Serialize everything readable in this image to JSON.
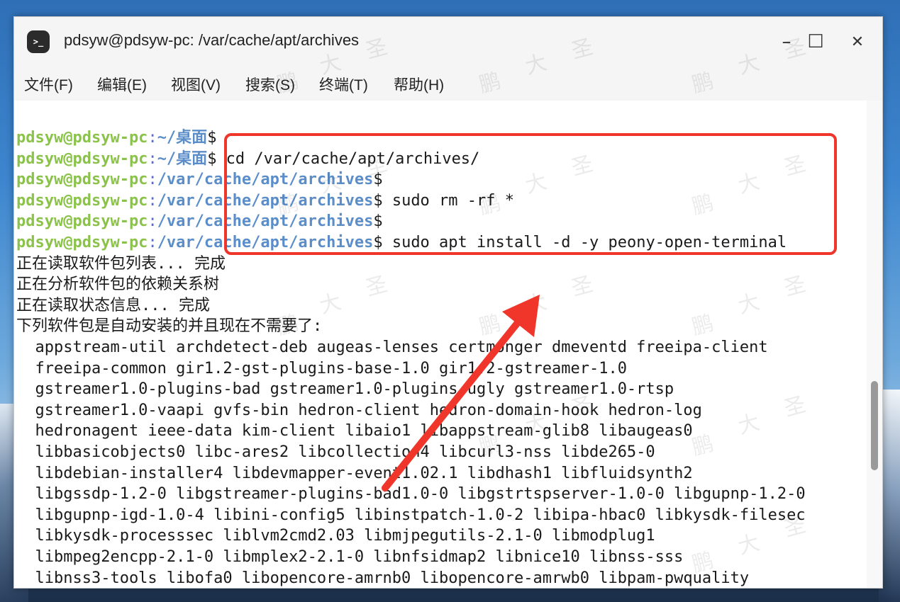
{
  "window": {
    "title": "pdsyw@pdsyw-pc: /var/cache/apt/archives",
    "icon_label": ">_",
    "controls": {
      "minimize": "–",
      "maximize": "☐",
      "close": "✕"
    }
  },
  "menu": [
    "文件(F)",
    "编辑(E)",
    "视图(V)",
    "搜索(S)",
    "终端(T)",
    "帮助(H)"
  ],
  "prompt": {
    "user": "pdsyw@pdsyw-pc",
    "sep": ":",
    "home_path": "~/桌面",
    "apt_path": "/var/cache/apt/archives",
    "dollar": "$"
  },
  "commands": [
    "",
    " cd /var/cache/apt/archives/",
    "",
    " sudo rm -rf *",
    "",
    " sudo apt install -d -y peony-open-terminal"
  ],
  "output": [
    "正在读取软件包列表... 完成",
    "正在分析软件包的依赖关系树",
    "正在读取状态信息... 完成",
    "下列软件包是自动安装的并且现在不需要了:",
    "  appstream-util archdetect-deb augeas-lenses certmonger dmeventd freeipa-client",
    "  freeipa-common gir1.2-gst-plugins-base-1.0 gir1.2-gstreamer-1.0",
    "  gstreamer1.0-plugins-bad gstreamer1.0-plugins-ugly gstreamer1.0-rtsp",
    "  gstreamer1.0-vaapi gvfs-bin hedron-client hedron-domain-hook hedron-log",
    "  hedronagent ieee-data kim-client libaio1 libappstream-glib8 libaugeas0",
    "  libbasicobjects0 libc-ares2 libcollection4 libcurl3-nss libde265-0",
    "  libdebian-installer4 libdevmapper-event1.02.1 libdhash1 libfluidsynth2",
    "  libgssdp-1.2-0 libgstreamer-plugins-bad1.0-0 libgstrtspserver-1.0-0 libgupnp-1.2-0",
    "  libgupnp-igd-1.0-4 libini-config5 libinstpatch-1.0-2 libipa-hbac0 libkysdk-filesec",
    "  libkysdk-processsec liblvm2cmd2.03 libmjpegutils-2.1-0 libmodplug1",
    "  libmpeg2encpp-2.1-0 libmplex2-2.1-0 libnfsidmap2 libnice10 libnss-sss",
    "  libnss3-tools libofa0 libopencore-amrnb0 libopencore-amrwb0 libpam-pwquality"
  ],
  "watermark_text": [
    "鹏",
    "大",
    "圣"
  ],
  "colors": {
    "prompt_user": "#8bc34a",
    "prompt_path": "#5b8ec9",
    "highlight": "#f0352b"
  }
}
